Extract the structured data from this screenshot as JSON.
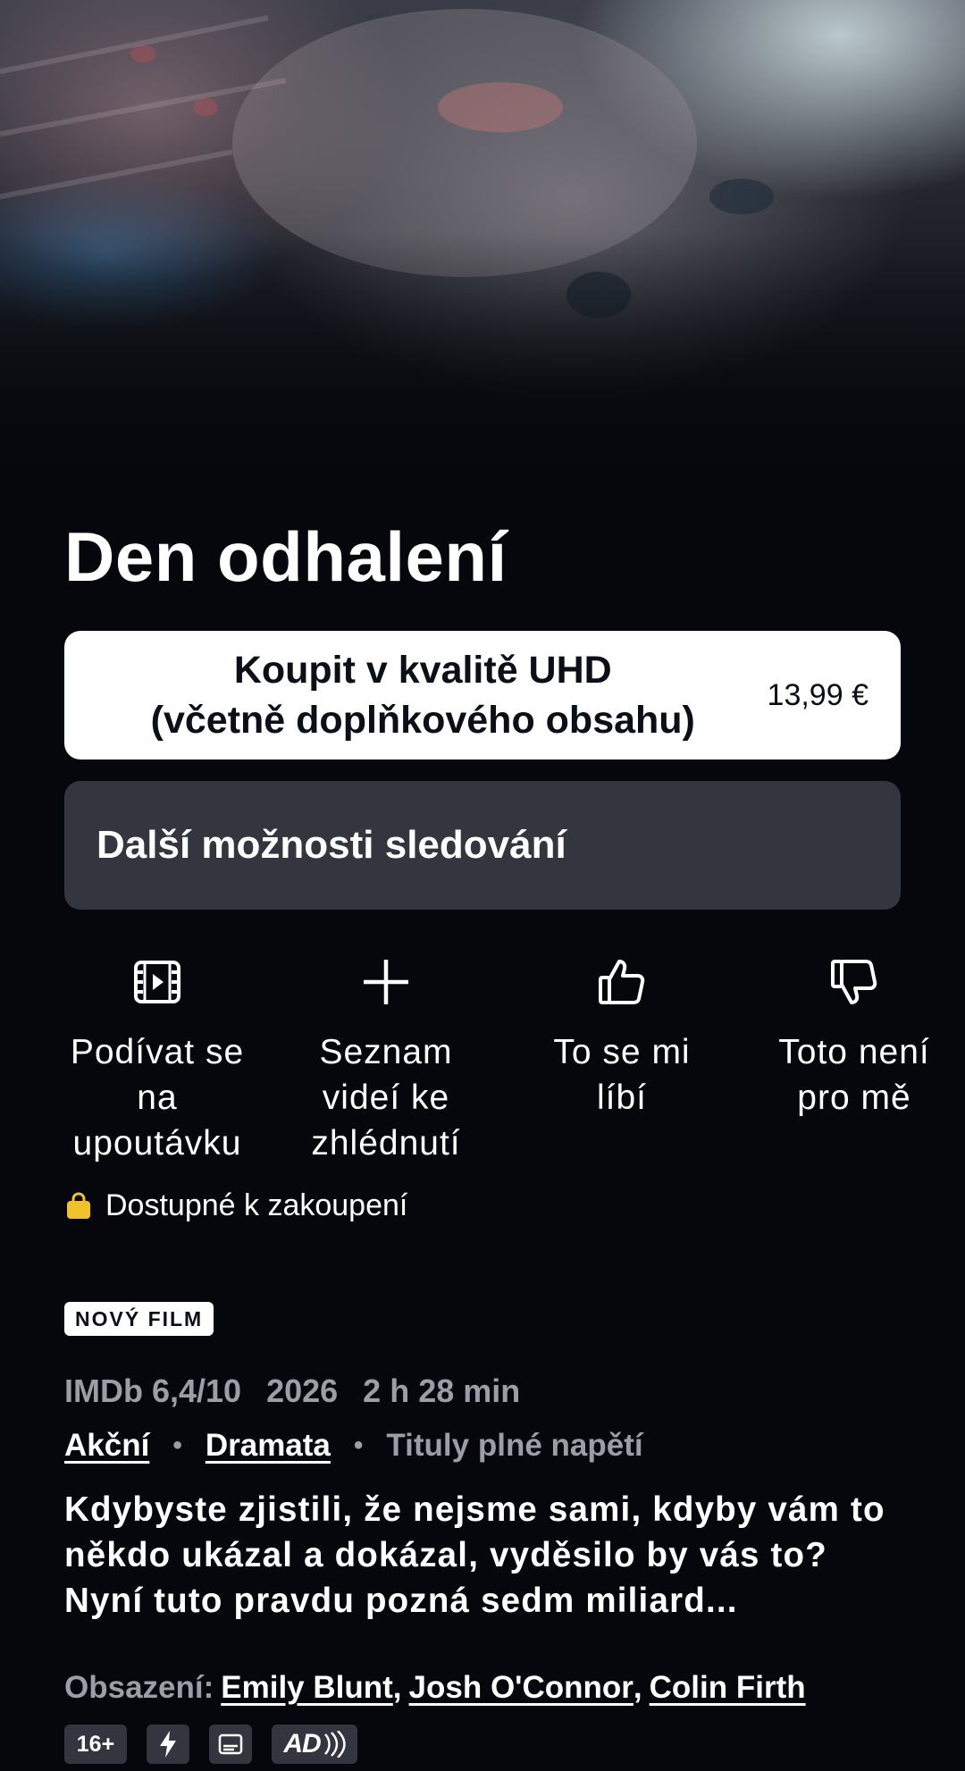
{
  "movie": {
    "title": "Den odhalení",
    "buy_button": {
      "line1": "Koupit v kvalitě UHD",
      "line2": "(včetně doplňkového obsahu)",
      "price": "13,99 €"
    },
    "more_options_label": "Další možnosti sledování",
    "actions": [
      {
        "icon": "trailer-icon",
        "line1": "Podívat se",
        "line2": "na",
        "line3": "upoutávku"
      },
      {
        "icon": "plus-icon",
        "line1": "Seznam",
        "line2": "videí ke",
        "line3": "zhlédnutí"
      },
      {
        "icon": "thumbs-up-icon",
        "line1": "To se mi",
        "line2": "líbí",
        "line3": ""
      },
      {
        "icon": "thumbs-down-icon",
        "line1": "Toto není",
        "line2": "pro mě",
        "line3": ""
      }
    ],
    "availability": "Dostupné k zakoupení",
    "badge": "NOVÝ FILM",
    "meta": {
      "imdb": "IMDb 6,4/10",
      "year": "2026",
      "duration": "2 h 28 min"
    },
    "genres": [
      "Akční",
      "Dramata",
      "Tituly plné napětí"
    ],
    "genre_separator": "•",
    "synopsis": "Kdybyste zjistili, že nejsme sami, kdyby vám to někdo ukázal a dokázal, vyděsilo by vás to? Nyní tuto pravdu pozná sedm miliard...",
    "cast_label": "Obsazení:",
    "cast": [
      "Emily Blunt",
      "Josh O'Connor",
      "Colin Firth"
    ],
    "cast_separator": ",",
    "rating_chip": "16+",
    "feature_icons": [
      "lightning-icon",
      "subtitles-icon",
      "audio-description-icon"
    ],
    "ad_label": "AD"
  },
  "colors": {
    "background": "#05070c",
    "button_secondary": "#33363f",
    "muted_text": "#9a9ea6",
    "availability_bag": "#f2c12e"
  }
}
